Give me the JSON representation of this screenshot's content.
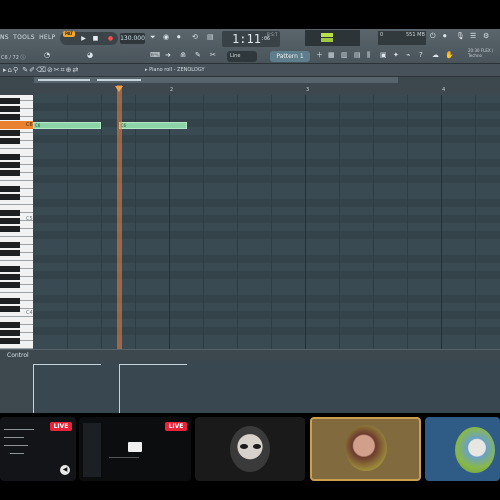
{
  "toolbar": {
    "menu": [
      "NS",
      "TOOLS",
      "HELP"
    ],
    "hint": "C6 / 72 ⓘ",
    "pat_badge": "PAT",
    "play": "▶",
    "stop": "■",
    "record": "●",
    "tempo": "130.000",
    "time_main": "1:11",
    "time_ticks": ":06",
    "time_unit": "B:S:T",
    "cpu": "551 MB",
    "cpu2": "0",
    "news": "20:30 FLEX / Techno",
    "snap": "Line",
    "pattern": "Pattern 1"
  },
  "piano_roll": {
    "title": "▸ Piano roll - ZENOLOGY",
    "bar_numbers": [
      "2",
      "3",
      "4"
    ],
    "key_labels": {
      "c6": "C6",
      "c5": "C5",
      "c4": "C4"
    },
    "notes": [
      {
        "label": "C6",
        "start": 1.0,
        "length": 0.5
      },
      {
        "label": "C6",
        "start": 1.63,
        "length": 0.5
      }
    ],
    "event_lane_label": "Control",
    "accent": "#f5a24a",
    "note_color": "#8dd3a8"
  },
  "stream_cards": [
    {
      "name": "card-1",
      "live": "LIVE"
    },
    {
      "name": "card-2",
      "live": "LIVE"
    },
    {
      "name": "card-3"
    },
    {
      "name": "card-4"
    },
    {
      "name": "card-5"
    }
  ]
}
